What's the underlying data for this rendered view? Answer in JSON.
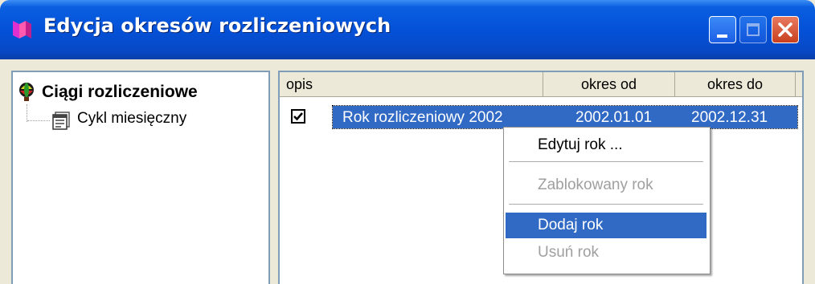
{
  "window": {
    "title": "Edycja okresów rozliczeniowych"
  },
  "tree": {
    "root_label": "Ciągi rozliczeniowe",
    "child_label": "Cykl miesięczny"
  },
  "list": {
    "columns": [
      "opis",
      "okres od",
      "okres do"
    ],
    "rows": [
      {
        "checked": true,
        "opis": "Rok rozliczeniowy 2002",
        "okres_od": "2002.01.01",
        "okres_do": "2002.12.31"
      }
    ]
  },
  "context_menu": {
    "items": [
      {
        "label": "Edytuj rok ...",
        "enabled": true
      },
      {
        "label": "Zablokowany rok",
        "enabled": false
      },
      {
        "label": "Dodaj rok",
        "enabled": true,
        "highlighted": true
      },
      {
        "label": "Usuń rok",
        "enabled": false
      }
    ]
  },
  "colors": {
    "titlebar": "#0451d8",
    "selection": "#316ac5",
    "close": "#c9401e",
    "disabled_text": "#9f9f9f"
  }
}
